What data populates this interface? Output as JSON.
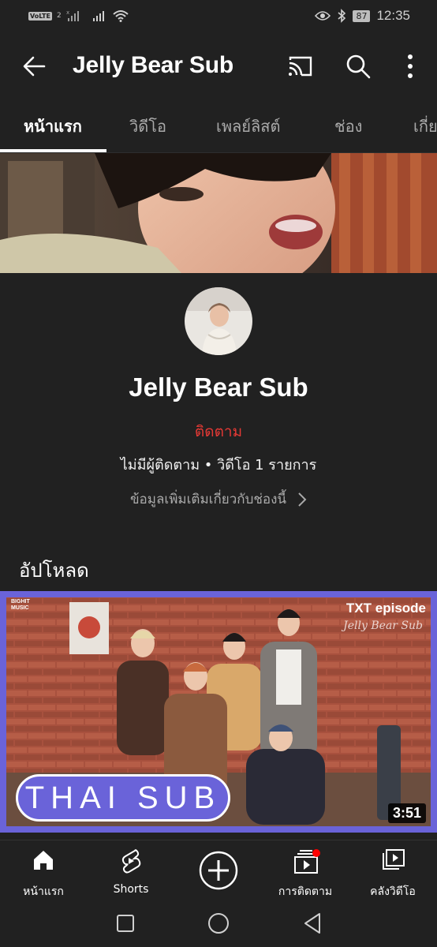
{
  "status_bar": {
    "volte": "VoLTE",
    "sim": "2",
    "battery": "87",
    "time": "12:35"
  },
  "app_bar": {
    "title": "Jelly Bear Sub",
    "icons": [
      "back-arrow-icon",
      "cast-icon",
      "search-icon",
      "more-vert-icon"
    ]
  },
  "tabs": [
    {
      "label": "หน้าแรก",
      "active": true
    },
    {
      "label": "วิดีโอ",
      "active": false
    },
    {
      "label": "เพลย์ลิสต์",
      "active": false
    },
    {
      "label": "ช่อง",
      "active": false
    },
    {
      "label": "เกี่ย",
      "active": false
    }
  ],
  "channel": {
    "name": "Jelly Bear Sub",
    "subscribe": "ติดตาม",
    "stats": "ไม่มีผู้ติดตาม • วิดีโอ 1 รายการ",
    "more_info": "ข้อมูลเพิ่มเติมเกี่ยวกับช่องนี้"
  },
  "uploads": {
    "title": "อัปโหลด",
    "video": {
      "badge_top_left": "BIGHIT MUSIC",
      "episode": "TXT episode",
      "watermark": "Jelly Bear Sub",
      "overlay": "THAI SUB",
      "duration": "3:51"
    }
  },
  "bottom_nav": [
    {
      "label": "หน้าแรก",
      "icon": "home-icon"
    },
    {
      "label": "Shorts",
      "icon": "shorts-icon"
    },
    {
      "label": "",
      "icon": "create-plus-icon"
    },
    {
      "label": "การติดตาม",
      "icon": "subscriptions-icon"
    },
    {
      "label": "คลังวิดีโอ",
      "icon": "library-icon"
    }
  ],
  "colors": {
    "background": "#212121",
    "subscribe_text": "#e53935",
    "notification_dot": "#ff0000",
    "thumbnail_frame": "#6a63d9"
  }
}
